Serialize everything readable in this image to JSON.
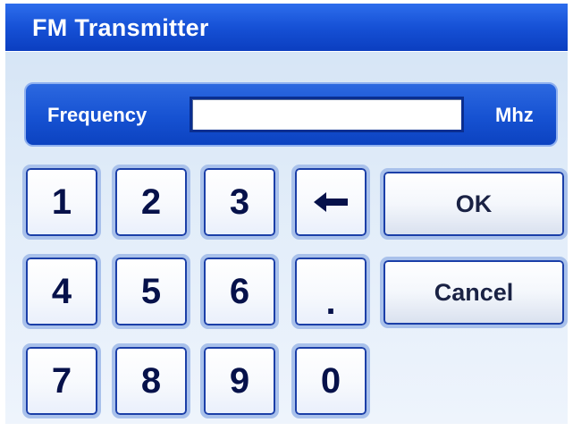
{
  "window": {
    "title": "FM Transmitter"
  },
  "frequency": {
    "label": "Frequency",
    "value": "",
    "placeholder": "",
    "unit": "Mhz"
  },
  "keypad": {
    "keys": [
      "1",
      "2",
      "3",
      "4",
      "5",
      "6",
      "7",
      "8",
      "9",
      "0",
      "."
    ],
    "backspace_icon": "left-arrow-icon",
    "ok_label": "OK",
    "cancel_label": "Cancel"
  },
  "colors": {
    "titlebar": "#1651d6",
    "background": "#dde9f7",
    "key_text": "#06114a",
    "key_border": "#1b3fa8"
  }
}
